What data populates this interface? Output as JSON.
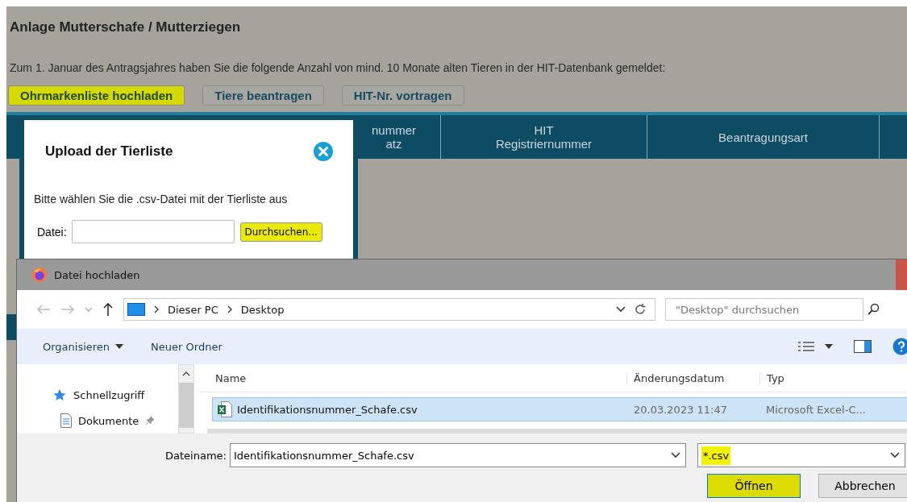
{
  "page": {
    "title": "Anlage Mutterschafe / Mutterziegen",
    "intro": "Zum 1. Januar des Antragsjahres haben Sie die folgende Anzahl von mind. 10 Monate alten Tieren in der HIT-Datenbank gemeldet:",
    "buttons": [
      {
        "label": "Ohrmarkenliste hochladen",
        "highlighted": true
      },
      {
        "label": "Tiere beantragen",
        "highlighted": false
      },
      {
        "label": "HIT-Nr. vortragen",
        "highlighted": false
      }
    ],
    "table": {
      "columns": [
        {
          "lines": [
            "nummer",
            "atz"
          ]
        },
        {
          "lines": [
            "HIT",
            "Registriernummer"
          ]
        },
        {
          "lines": [
            "Beantragungsart"
          ]
        }
      ]
    }
  },
  "upload_modal": {
    "title": "Upload der Tierliste",
    "instruction": "Bitte wählen Sie die .csv-Datei mit der Tierliste aus",
    "file_label": "Datei:",
    "browse_button": {
      "label": "Durchsuchen...",
      "highlighted": true
    }
  },
  "file_dialog": {
    "title": "Datei hochladen",
    "path": [
      "Dieser PC",
      "Desktop"
    ],
    "search": {
      "placeholder": "\"Desktop\" durchsuchen"
    },
    "toolbar": [
      {
        "label": "Organisieren",
        "dropdown": true
      },
      {
        "label": "Neuer Ordner",
        "dropdown": false
      }
    ],
    "nav": [
      {
        "label": "Schnellzugriff",
        "kind": "star"
      },
      {
        "label": "Dokumente",
        "kind": "document"
      }
    ],
    "columns": [
      "Name",
      "Änderungsdatum",
      "Typ"
    ],
    "files": [
      {
        "name": "Identifikationsnummer_Schafe.csv",
        "date": "20.03.2023 11:47",
        "type": "Microsoft Excel-C...",
        "selected": true
      }
    ],
    "filename_label": "Dateiname:",
    "filename": "Identifikationsnummer_Schafe.csv",
    "filter": {
      "value": "*.csv",
      "highlighted": true
    },
    "buttons": [
      {
        "label": "Öffnen",
        "highlighted": true
      },
      {
        "label": "Abbrechen",
        "highlighted": false
      }
    ]
  }
}
